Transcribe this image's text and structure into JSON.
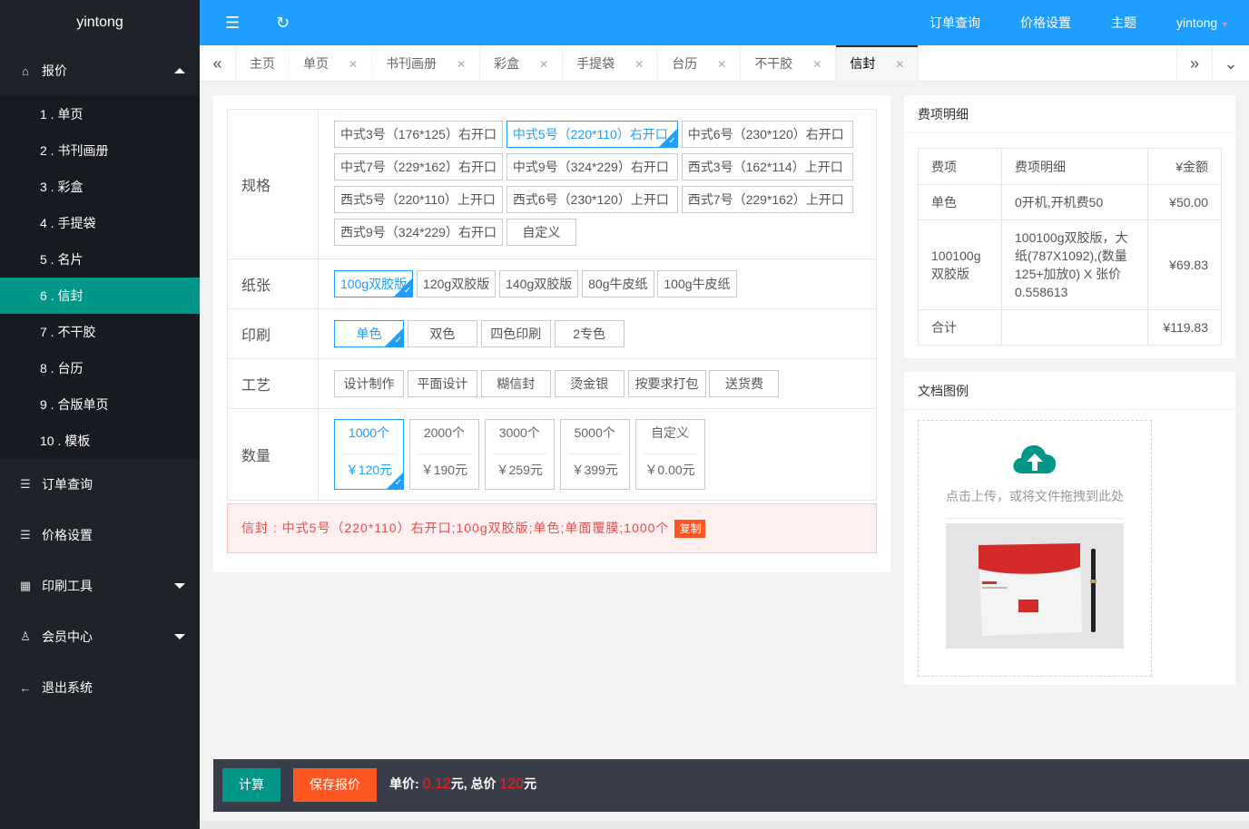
{
  "sidebar": {
    "logo": "yintong",
    "quote": "报价",
    "items": [
      "1 . 单页",
      "2 . 书刊画册",
      "3 . 彩盒",
      "4 . 手提袋",
      "5 . 名片",
      "6 . 信封",
      "7 . 不干胶",
      "8 . 台历",
      "9 . 合版单页",
      "10 . 模板"
    ],
    "orders": "订单查询",
    "price_setting": "价格设置",
    "print_tools": "印刷工具",
    "member": "会员中心",
    "logout": "退出系统"
  },
  "topbar": {
    "links": [
      "订单查询",
      "价格设置",
      "主题",
      "yintong"
    ]
  },
  "tabs": [
    "主页",
    "单页",
    "书刊画册",
    "彩盒",
    "手提袋",
    "台历",
    "不干胶",
    "信封"
  ],
  "form": {
    "spec_label": "规格",
    "specs": [
      "中式3号（176*125）右开口",
      "中式5号（220*110）右开口",
      "中式6号（230*120）右开口",
      "中式7号（229*162）右开口",
      "中式9号（324*229）右开口",
      "西式3号（162*114）上开口",
      "西式5号（220*110）上开口",
      "西式6号（230*120）上开口",
      "西式7号（229*162）上开口",
      "西式9号（324*229）右开口",
      "自定义"
    ],
    "paper_label": "纸张",
    "papers": [
      "100g双胶版",
      "120g双胶版",
      "140g双胶版",
      "80g牛皮纸",
      "100g牛皮纸"
    ],
    "print_label": "印刷",
    "prints": [
      "单色",
      "双色",
      "四色印刷",
      "2专色"
    ],
    "craft_label": "工艺",
    "crafts": [
      "设计制作",
      "平面设计",
      "糊信封",
      "烫金银",
      "按要求打包",
      "送货费"
    ],
    "qty_label": "数量",
    "qtys": [
      {
        "q": "1000个",
        "p": "￥120元"
      },
      {
        "q": "2000个",
        "p": "￥190元"
      },
      {
        "q": "3000个",
        "p": "￥259元"
      },
      {
        "q": "5000个",
        "p": "￥399元"
      },
      {
        "q": "自定义",
        "p": "￥0.00元"
      }
    ],
    "summary": "信封 : 中式5号（220*110）右开口;100g双胶版;单色;单面覆膜;1000个",
    "copy": "复制"
  },
  "fee": {
    "title": "费项明细",
    "headers": [
      "费项",
      "费项明细",
      "¥金额"
    ],
    "rows": [
      [
        "单色",
        "0开机,开机费50",
        "¥50.00"
      ],
      [
        "100100g双胶版",
        "100100g双胶版，大纸(787X1092),(数量125+加放0) X 张价0.558613",
        "¥69.83"
      ],
      [
        "合计",
        "",
        "¥119.83"
      ]
    ]
  },
  "doc": {
    "title": "文档图例",
    "upload_text": "点击上传，或将文件拖拽到此处"
  },
  "bottom": {
    "calc": "计算",
    "save": "保存报价",
    "unit_label": "单价:",
    "unit_value": "0.12",
    "unit_suffix": "元, 总价",
    "total_value": "120",
    "total_suffix": "元"
  },
  "colors": {
    "sidebar": "#20222a",
    "active": "#009688",
    "topbar": "#1e9fff",
    "danger": "#ff5722"
  }
}
